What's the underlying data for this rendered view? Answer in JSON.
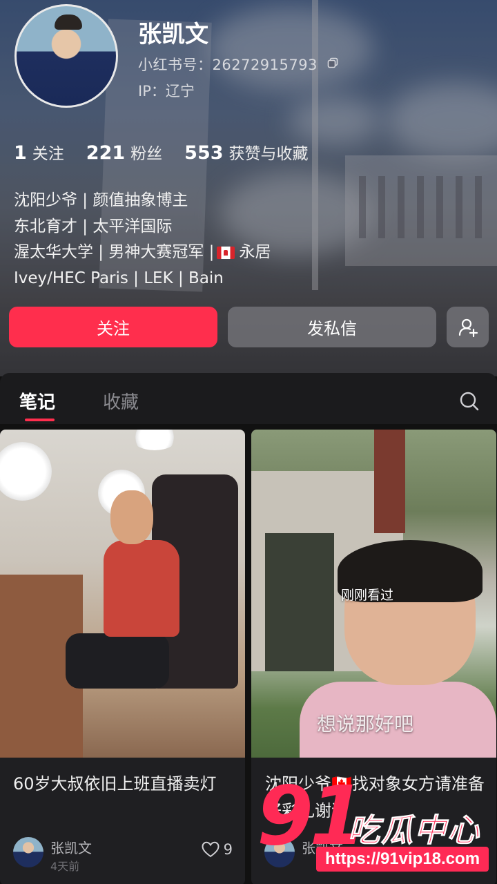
{
  "profile": {
    "name": "张凯文",
    "rednote_id": "小红书号：26272915793",
    "ip": "IP：辽宁",
    "stats": [
      {
        "value": "1",
        "label": "关注"
      },
      {
        "value": "221",
        "label": "粉丝"
      },
      {
        "value": "553",
        "label": "获赞与收藏"
      }
    ],
    "bio": {
      "line1": "沈阳少爷 | 颜值抽象博主",
      "line2": "东北育才 | 太平洋国际",
      "line3_a": "渥太华大学 | 男神大赛冠军 |",
      "line3_b": "永居",
      "line4": "Ivey/HEC Paris  |  LEK  |  Bain"
    }
  },
  "actions": {
    "follow_label": "关注",
    "message_label": "发私信"
  },
  "tabs": {
    "notes": "笔记",
    "favorites": "收藏"
  },
  "feed": [
    {
      "title": "60岁大叔依旧上班直播卖灯",
      "author": "张凯文",
      "time": "4天前",
      "likes": "9"
    },
    {
      "title": "沈阳少爷🇨🇦找对象女方请准备好彩礼谢谢",
      "overlay_seen": "刚刚看过",
      "overlay_subtitle": "想说那好吧",
      "author": "张凯文"
    }
  ],
  "watermark": {
    "number": "91",
    "text": "吃瓜中心",
    "url": "https://91vip18.com"
  },
  "colors": {
    "accent": "#ff2e4d",
    "tab_bg": "#1b1b1d",
    "card_bg": "#1f1f22"
  },
  "icons": [
    "copy-icon",
    "add-user-icon",
    "search-icon",
    "heart-icon",
    "canada-flag-icon"
  ]
}
